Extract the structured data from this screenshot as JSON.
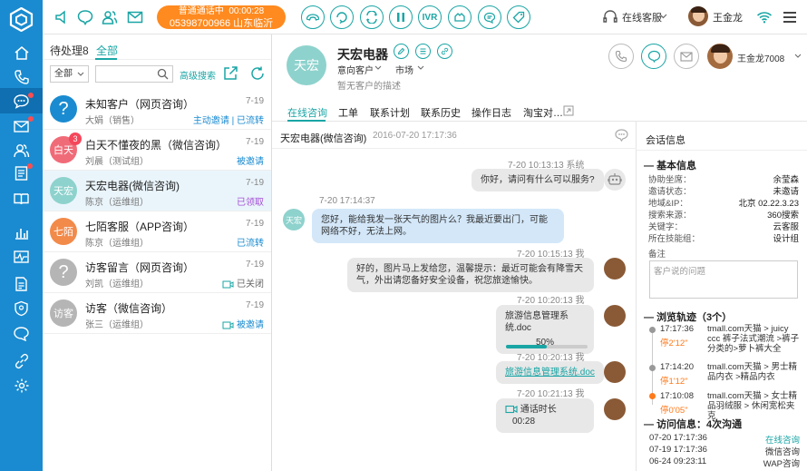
{
  "colors": {
    "rail": "#1a8bd0",
    "accent": "#1aa5a5",
    "call": "#ff8a1f",
    "badge": "#f5475b"
  },
  "rail_icons": [
    "logo-icon",
    "home-icon",
    "phone-icon",
    "chat-icon",
    "mail-icon",
    "contacts-icon",
    "tasks-icon",
    "book-icon",
    "stats-icon",
    "monitor-icon",
    "report-icon",
    "shield-icon",
    "message-icon",
    "link-icon",
    "settings-icon"
  ],
  "topbar": {
    "call_status": "普通通话中",
    "call_timer": "00:00:28",
    "call_number": "05398700966 山东临沂",
    "ivr_label": "IVR",
    "agent_status": "在线客服",
    "user_name": "王金龙"
  },
  "list": {
    "tab_pending": "待处理8",
    "tab_all": "全部",
    "filter_value": "全部",
    "search_placeholder": "",
    "advanced_search": "高级搜索",
    "items": [
      {
        "title": "未知客户（网页咨询）",
        "sub": "大娟（销售）",
        "time": "7-19",
        "status": "主动邀请",
        "status2": "已流转",
        "avatar": "?",
        "avatar_color": "#1a8bd0"
      },
      {
        "title": "白天不懂夜的黑（微信咨询）",
        "sub": "刘晨（测试组）",
        "time": "7-19",
        "status": "被邀请",
        "avatar": "白天",
        "avatar_color": "#f06b78",
        "badge": "3"
      },
      {
        "title": "天宏电器(微信咨询)",
        "sub": "陈京（运维组）",
        "time": "7-19",
        "status": "已领取",
        "avatar": "天宏",
        "avatar_color": "#8ed2cd"
      },
      {
        "title": "七陌客服（APP咨询）",
        "sub": "陈京（运维组）",
        "time": "7-19",
        "status": "已流转",
        "avatar": "七陌",
        "avatar_color": "#f28a4a"
      },
      {
        "title": "访客留言（网页咨询）",
        "sub": "刘凯（运维组）",
        "time": "7-19",
        "status": "已关闭",
        "avatar": "?",
        "avatar_color": "#b5b5b5"
      },
      {
        "title": "访客（微信咨询）",
        "sub": "张三（运维组）",
        "time": "7-19",
        "status": "被邀请",
        "avatar": "访客",
        "avatar_color": "#b5b5b5"
      }
    ]
  },
  "profile": {
    "avatar": "天宏",
    "name": "天宏电器",
    "tag1": "意向客户",
    "tag2": "市场",
    "desc": "暂无客户的描述",
    "me_name": "王金龙7008"
  },
  "main_tabs": [
    "在线咨询",
    "工单",
    "联系计划",
    "联系历史",
    "操作日志",
    "淘宝对…"
  ],
  "chat": {
    "title": "天宏电器(微信咨询)",
    "date": "2016-07-20 17:17:36",
    "messages": [
      {
        "meta": "7-20  10:13:13  系统",
        "text": "你好，请问有什么可以服务?"
      },
      {
        "meta": "7-20  17:14:37",
        "text": "您好，能给我发一张天气的图片么？我最近要出门，可能网络不好，无法上网。",
        "avatar": "天宏"
      },
      {
        "meta": "7-20  10:15:13  我",
        "text": "好的，图片马上发给您，温馨提示：最近可能会有降雪天气，外出请您备好安全设备，祝您旅途愉快。"
      },
      {
        "meta": "7-20  10:20:13  我",
        "text": "旅游信息管理系统.doc",
        "progress": "50%",
        "progress_value": 0.5
      },
      {
        "meta": "7-20  10:20:13  我",
        "text": "旅游信息管理系统.doc"
      },
      {
        "meta": "7-20  10:21:13  我",
        "text": "通话时长",
        "duration": "00:28"
      }
    ]
  },
  "info": {
    "title": "会话信息",
    "basic_title": "基本信息",
    "basic": [
      {
        "k": "协助坐席：",
        "v": "余莹森"
      },
      {
        "k": "邀请状态：",
        "v": "未邀请"
      },
      {
        "k": "地域&IP：",
        "v": "北京 02.22.3.23"
      },
      {
        "k": "搜索来源：",
        "v": "360搜索"
      },
      {
        "k": "关键字：",
        "v": "云客服"
      },
      {
        "k": "所在技能组：",
        "v": "设计组"
      }
    ],
    "note_label": "备注",
    "note_placeholder": "客户说的问题",
    "trail_title": "浏览轨迹（3个）",
    "trail": [
      {
        "time": "17:17:36",
        "dur": "停2'12\"",
        "page": "tmall.com天猫 > juicy ccc 裤子法式潮流 >裤子分类的>萝卜裤大全"
      },
      {
        "time": "17:14:20",
        "dur": "停1'12\"",
        "page": "tmall.com天猫 > 男士精品内衣 >精品内衣"
      },
      {
        "time": "17:10:08",
        "dur": "停0'05\"",
        "page": "tmall.com天猫 > 女士精品羽绒服 > 休闲宽松夹克"
      }
    ],
    "visit_title": "访问信息：4次沟通",
    "visits": [
      {
        "date": "07-20  17:17:36",
        "channel": "在线咨询",
        "color": "#1aa5a5"
      },
      {
        "date": "07-19  17:17:36",
        "channel": "微信咨询",
        "color": "#333"
      },
      {
        "date": "06-24  09:23:11",
        "channel": "WAP咨询",
        "color": "#333"
      }
    ]
  }
}
